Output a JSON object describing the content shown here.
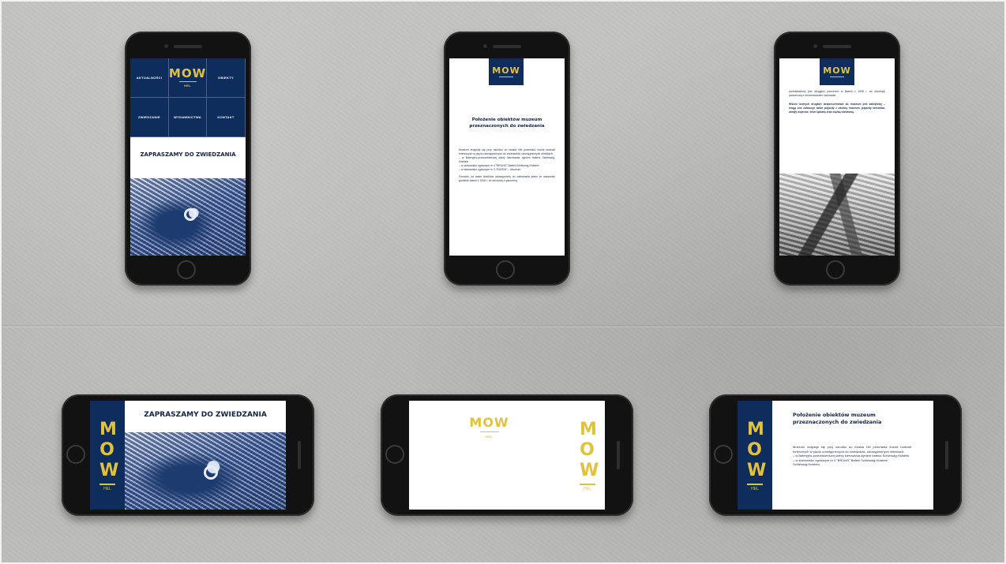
{
  "logo": {
    "text": "MOW",
    "subtext": "HEL"
  },
  "menu": [
    "AKTUALNOŚCI",
    "OBIEKTY",
    "ZWIEDZANIE",
    "WYDAWNICTWA",
    "KONTAKT"
  ],
  "banner_heading": "ZAPRASZAMY DO ZWIEDZANIA",
  "article": {
    "heading": "Położenie obiektów muzeum przeznaczonych do zwiedzania",
    "intro": "Muzeum znajduje się przy ośrodku do miasta Hel przemłaść licznie budowli fortecznych w pięciu udostępnionych do zwiedzania, udostępnionych obiektach:",
    "items": [
      "– w Bateryjno-przeciwlotniczej wieży kierowania ogniem bateria Schleswig-Holstein",
      "– w stanowisku ogniowym nr 4 \"BRUNO\" Baterii Schleswig-Holstein",
      "– w stanowisku ogniowym nr 3 \"RAFEW\" – Muzeum"
    ],
    "extra_landscape": "Schleswig-Holstein",
    "more": "Ponadto, na trasie obiektów udostępniony do zwiedzania jeden ze stanowisk grodzisk baterii z 1936 r. do obrotowy z pancerną."
  },
  "article2": {
    "para1": "przedstawiony jest okrągłym pancerem w Baterii z 1936 r. do obrotowy pancerową z obramowaniem stanowisk.",
    "para2": "Wśród licznych drogach bezpieczeństwa do muzeum jest zakrętowy – mogą one zobaczyć także pojazdy z okolicy muzeum, pojazdy lotnictwa, okręty wojenne, broń lądową oraz ciężką obrotową."
  },
  "colors": {
    "navy": "#0f2d5c",
    "gold": "#e2c23a",
    "concrete": "#b9b9b7"
  }
}
